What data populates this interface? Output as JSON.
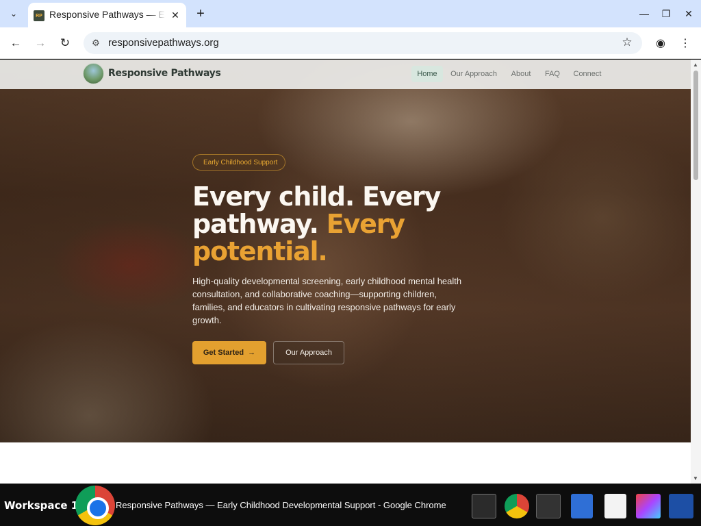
{
  "browser": {
    "tab_title": "Responsive Pathways — Early Childhood Developmental Support",
    "favicon_text": "RP",
    "url": "responsivepathways.org"
  },
  "site": {
    "brand": "Responsive Pathways",
    "nav": [
      {
        "label": "Home",
        "active": true
      },
      {
        "label": "Our Approach",
        "active": false
      },
      {
        "label": "About",
        "active": false
      },
      {
        "label": "FAQ",
        "active": false
      },
      {
        "label": "Connect",
        "active": false
      }
    ]
  },
  "hero": {
    "badge": "Early Childhood Support",
    "headline_part1": "Every child. Every pathway. ",
    "headline_accent": "Every potential.",
    "lead": "High-quality developmental screening, early childhood mental health consultation, and collaborative coaching—supporting children, families, and educators in cultivating responsive pathways for early growth.",
    "primary_cta": "Get Started",
    "secondary_cta": "Our Approach",
    "accent_color": "#e9a233"
  },
  "taskbar": {
    "workspace": "Workspace 1",
    "window_title": "Responsive Pathways — Early Childhood Developmental Support - Google Chrome"
  }
}
